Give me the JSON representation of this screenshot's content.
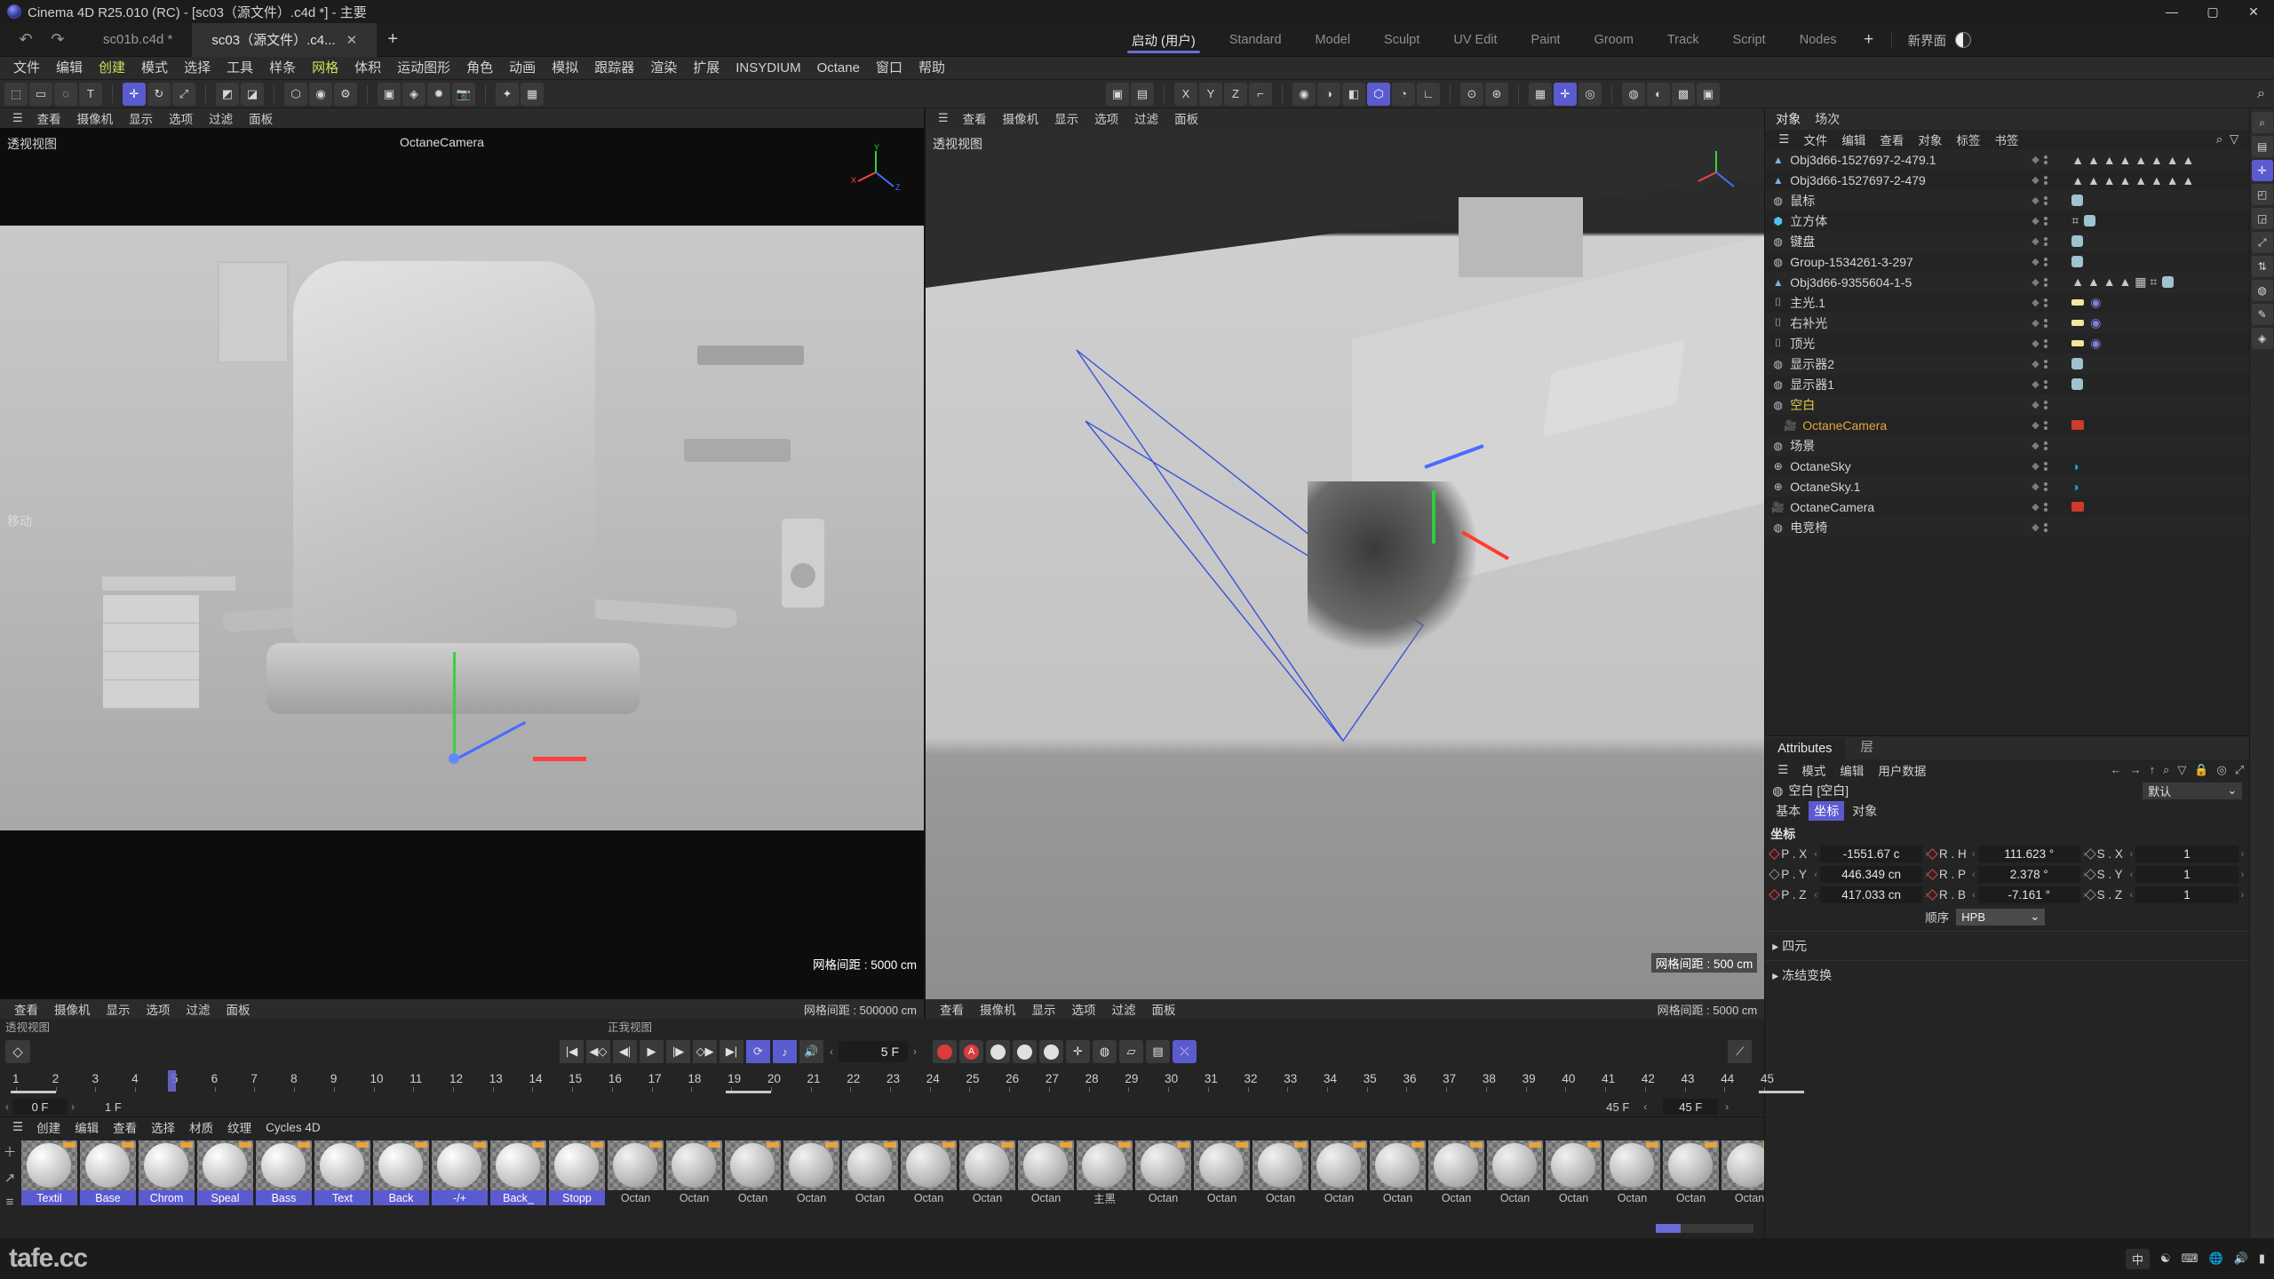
{
  "window": {
    "title": "Cinema 4D R25.010 (RC) - [sc03（源文件）.c4d *] - 主要",
    "minimize": "—",
    "maximize": "▢",
    "close": "✕"
  },
  "tabbar": {
    "undo": "↶",
    "redo": "↷",
    "documents": [
      {
        "label": "sc01b.c4d *",
        "active": false,
        "close": ""
      },
      {
        "label": "sc03（源文件）.c4...",
        "active": true,
        "close": "✕"
      }
    ],
    "add": "+",
    "layouts": [
      {
        "label": "启动 (用户)",
        "active": true
      },
      {
        "label": "Standard",
        "active": false
      },
      {
        "label": "Model",
        "active": false
      },
      {
        "label": "Sculpt",
        "active": false
      },
      {
        "label": "UV Edit",
        "active": false
      },
      {
        "label": "Paint",
        "active": false
      },
      {
        "label": "Groom",
        "active": false
      },
      {
        "label": "Track",
        "active": false
      },
      {
        "label": "Script",
        "active": false
      },
      {
        "label": "Nodes",
        "active": false
      }
    ],
    "layout_add": "+",
    "new_ui_label": "新界面"
  },
  "menubar": {
    "items": [
      {
        "label": "文件",
        "hl": false
      },
      {
        "label": "编辑",
        "hl": false
      },
      {
        "label": "创建",
        "hl": true
      },
      {
        "label": "模式",
        "hl": false
      },
      {
        "label": "选择",
        "hl": false
      },
      {
        "label": "工具",
        "hl": false
      },
      {
        "label": "样条",
        "hl": false
      },
      {
        "label": "网格",
        "hl": true
      },
      {
        "label": "体积",
        "hl": false
      },
      {
        "label": "运动图形",
        "hl": false
      },
      {
        "label": "角色",
        "hl": false
      },
      {
        "label": "动画",
        "hl": false
      },
      {
        "label": "模拟",
        "hl": false
      },
      {
        "label": "跟踪器",
        "hl": false
      },
      {
        "label": "渲染",
        "hl": false
      },
      {
        "label": "扩展",
        "hl": false
      },
      {
        "label": "INSYDIUM",
        "hl": false
      },
      {
        "label": "Octane",
        "hl": false
      },
      {
        "label": "窗口",
        "hl": false
      },
      {
        "label": "帮助",
        "hl": false
      }
    ]
  },
  "toolbar_left": {
    "groups": [
      {
        "buttons": [
          {
            "icon": "⬚",
            "name": "live-selection-tool",
            "on": false
          },
          {
            "icon": "▭",
            "name": "rectangle-selection-tool",
            "on": false
          },
          {
            "icon": "◌",
            "name": "lasso-selection-tool",
            "on": false
          },
          {
            "icon": "T",
            "name": "text-tool",
            "on": false
          }
        ]
      },
      {
        "buttons": [
          {
            "icon": "✛",
            "name": "move-tool",
            "on": true
          },
          {
            "icon": "↻",
            "name": "rotate-tool",
            "on": false
          },
          {
            "icon": "⤢",
            "name": "scale-tool",
            "on": false
          }
        ]
      },
      {
        "buttons": [
          {
            "icon": "◩",
            "name": "undo-view-button",
            "on": false
          },
          {
            "icon": "◪",
            "name": "redo-view-button",
            "on": false
          }
        ]
      },
      {
        "buttons": [
          {
            "icon": "⬡",
            "name": "render-view-button",
            "on": false
          },
          {
            "icon": "◉",
            "name": "render-region-button",
            "on": false
          },
          {
            "icon": "⚙",
            "name": "render-settings-button",
            "on": false
          }
        ]
      },
      {
        "buttons": [
          {
            "icon": "▣",
            "name": "add-cube-button",
            "on": false
          },
          {
            "icon": "◈",
            "name": "add-spline-button",
            "on": false
          },
          {
            "icon": "✹",
            "name": "add-light-button",
            "on": false
          },
          {
            "icon": "📷",
            "name": "add-camera-button",
            "on": false
          }
        ]
      },
      {
        "buttons": [
          {
            "icon": "✦",
            "name": "deformer-button",
            "on": false
          },
          {
            "icon": "▦",
            "name": "array-button",
            "on": false
          }
        ]
      }
    ]
  },
  "toolbar_right": {
    "groups": [
      {
        "buttons": [
          {
            "icon": "▣",
            "name": "object-axis-toggle",
            "on": false
          },
          {
            "icon": "▤",
            "name": "world-axis-toggle",
            "on": false
          }
        ]
      },
      {
        "buttons": [
          {
            "icon": "X",
            "name": "lock-x-axis-button",
            "on": false
          },
          {
            "icon": "Y",
            "name": "lock-y-axis-button",
            "on": false
          },
          {
            "icon": "Z",
            "name": "lock-z-axis-button",
            "on": false
          },
          {
            "icon": "⌐",
            "name": "world-coordinates-toggle",
            "on": false
          }
        ]
      },
      {
        "buttons": [
          {
            "icon": "◉",
            "name": "point-mode-button",
            "on": false
          },
          {
            "icon": "◑",
            "name": "edge-mode-button",
            "on": false
          },
          {
            "icon": "◧",
            "name": "polygon-mode-button",
            "on": false
          },
          {
            "icon": "⬡",
            "name": "model-mode-button",
            "on": true
          },
          {
            "icon": "◔",
            "name": "texture-mode-button",
            "on": false
          },
          {
            "icon": "∟",
            "name": "axis-mode-button",
            "on": false
          }
        ]
      },
      {
        "buttons": [
          {
            "icon": "⊙",
            "name": "enable-axis-button",
            "on": false
          },
          {
            "icon": "⊛",
            "name": "enable-snap-button",
            "on": false
          }
        ]
      },
      {
        "buttons": [
          {
            "icon": "▦",
            "name": "grid-snap-button",
            "on": false
          },
          {
            "icon": "✛",
            "name": "quantize-button",
            "on": true
          },
          {
            "icon": "◎",
            "name": "workplane-button",
            "on": false
          }
        ]
      },
      {
        "buttons": [
          {
            "icon": "◍",
            "name": "viewport-solo-button",
            "on": false
          },
          {
            "icon": "◐",
            "name": "layer-button",
            "on": false
          },
          {
            "icon": "▩",
            "name": "content-browser-button",
            "on": false
          },
          {
            "icon": "▣",
            "name": "asset-browser-button",
            "on": false
          }
        ]
      }
    ],
    "search_icon": "⌕"
  },
  "viewport_left": {
    "menu": [
      "查看",
      "摄像机",
      "显示",
      "选项",
      "过滤",
      "面板"
    ],
    "hamburger": "☰",
    "label": "透视视图",
    "camera": "OctaneCamera",
    "tool_label": "移动",
    "grid_spacing": "网格间距 : 5000 cm",
    "bottom_menu": [
      "查看",
      "摄像机",
      "显示",
      "选项",
      "过滤",
      "面板"
    ],
    "bottom_grid": "网格间距 : 500000 cm",
    "bottom_view_label": "透视视图"
  },
  "viewport_right": {
    "menu": [
      "查看",
      "摄像机",
      "显示",
      "选项",
      "过滤",
      "面板"
    ],
    "hamburger": "☰",
    "label": "透视视图",
    "grid_spacing": "网格间距 : 500 cm",
    "bottom_menu": [
      "查看",
      "摄像机",
      "显示",
      "选项",
      "过滤",
      "面板"
    ],
    "bottom_grid": "网格间距 : 5000 cm",
    "bottom_view_label": "正我视图"
  },
  "timeline": {
    "key_button_icon": "◇",
    "transport": [
      {
        "icon": "|◀",
        "name": "go-to-start-button",
        "on": false
      },
      {
        "icon": "◀◇",
        "name": "previous-key-button",
        "on": false
      },
      {
        "icon": "◀|",
        "name": "previous-frame-button",
        "on": false
      },
      {
        "icon": "▶",
        "name": "play-button",
        "on": false
      },
      {
        "icon": "|▶",
        "name": "next-frame-button",
        "on": false
      },
      {
        "icon": "◇▶",
        "name": "next-key-button",
        "on": false
      },
      {
        "icon": "▶|",
        "name": "go-to-end-button",
        "on": false
      },
      {
        "icon": "⟳",
        "name": "loop-toggle",
        "on": true
      },
      {
        "icon": "♪",
        "name": "sound-toggle",
        "on": true
      },
      {
        "icon": "🔊",
        "name": "audio-button",
        "on": false
      }
    ],
    "current_frame": "5 F",
    "record_buttons": [
      {
        "icon": "◉",
        "name": "record-keyframe-button",
        "style": "red"
      },
      {
        "icon": "A",
        "name": "autokey-button",
        "style": "red"
      },
      {
        "icon": "✛",
        "name": "record-position-button",
        "style": "grey"
      },
      {
        "icon": "◑",
        "name": "record-scale-button",
        "style": "grey"
      },
      {
        "icon": "◎",
        "name": "record-rotation-button",
        "style": "grey"
      },
      {
        "icon": "✛",
        "name": "keyframe-position-toggle",
        "style": "plain"
      },
      {
        "icon": "◍",
        "name": "keyframe-scale-toggle",
        "style": "plain"
      },
      {
        "icon": "▱",
        "name": "keyframe-rotation-toggle",
        "style": "plain"
      },
      {
        "icon": "▤",
        "name": "keyframe-param-toggle",
        "style": "plain"
      },
      {
        "icon": "⤫",
        "name": "keyframe-pla-toggle",
        "style": "on"
      }
    ],
    "curve_button_icon": "⟋",
    "frames": [
      1,
      2,
      3,
      4,
      5,
      6,
      7,
      8,
      9,
      10,
      11,
      12,
      13,
      14,
      15,
      16,
      17,
      18,
      19,
      20,
      21,
      22,
      23,
      24,
      25,
      26,
      27,
      28,
      29,
      30,
      31,
      32,
      33,
      34,
      35,
      36,
      37,
      38,
      39,
      40,
      41,
      42,
      43,
      44,
      45
    ],
    "playhead_frame": 5,
    "range_start": "0 F",
    "range_preview_start": "1 F",
    "range_preview_end": "45 F",
    "range_end": "45 F"
  },
  "materials": {
    "menu": [
      "创建",
      "编辑",
      "查看",
      "选择",
      "材质",
      "纹理",
      "Cycles 4D"
    ],
    "hamburger": "☰",
    "side_buttons": [
      "＋",
      "↗",
      "≡"
    ],
    "items": [
      {
        "name": "Textil",
        "kind": "std"
      },
      {
        "name": "Base",
        "kind": "std"
      },
      {
        "name": "Chrom",
        "kind": "std"
      },
      {
        "name": "Speal",
        "kind": "std"
      },
      {
        "name": "Bass",
        "kind": "std"
      },
      {
        "name": "Text",
        "kind": "std"
      },
      {
        "name": "Back",
        "kind": "std"
      },
      {
        "name": "-/+",
        "kind": "std"
      },
      {
        "name": "Back_",
        "kind": "std"
      },
      {
        "name": "Stopp",
        "kind": "std"
      },
      {
        "name": "Octan",
        "kind": "oct"
      },
      {
        "name": "Octan",
        "kind": "oct"
      },
      {
        "name": "Octan",
        "kind": "oct"
      },
      {
        "name": "Octan",
        "kind": "oct"
      },
      {
        "name": "Octan",
        "kind": "oct"
      },
      {
        "name": "Octan",
        "kind": "oct"
      },
      {
        "name": "Octan",
        "kind": "oct"
      },
      {
        "name": "Octan",
        "kind": "oct"
      },
      {
        "name": "主黑",
        "kind": "oct"
      },
      {
        "name": "Octan",
        "kind": "oct"
      },
      {
        "name": "Octan",
        "kind": "oct"
      },
      {
        "name": "Octan",
        "kind": "oct"
      },
      {
        "name": "Octan",
        "kind": "oct"
      },
      {
        "name": "Octan",
        "kind": "oct"
      },
      {
        "name": "Octan",
        "kind": "oct"
      },
      {
        "name": "Octan",
        "kind": "oct"
      },
      {
        "name": "Octan",
        "kind": "oct"
      },
      {
        "name": "Octan",
        "kind": "oct"
      },
      {
        "name": "Octan",
        "kind": "oct"
      },
      {
        "name": "Octan",
        "kind": "oct"
      }
    ]
  },
  "object_manager": {
    "tabs": [
      {
        "label": "对象",
        "active": true
      },
      {
        "label": "场次",
        "active": false
      }
    ],
    "menu": [
      "文件",
      "编辑",
      "查看",
      "对象",
      "标签",
      "书签"
    ],
    "hamburger": "☰",
    "search_icon": "⌕",
    "filter_icon": "▽",
    "items": [
      {
        "name": "Obj3d66-1527697-2-479.1",
        "icon": "▲",
        "icon_color": "#7fb0d8",
        "indent": 0,
        "state": "normal",
        "tags": "polys"
      },
      {
        "name": "Obj3d66-1527697-2-479",
        "icon": "▲",
        "icon_color": "#7fb0d8",
        "indent": 0,
        "state": "normal",
        "tags": "polys"
      },
      {
        "name": "鼠标",
        "icon": "◍",
        "icon_color": "#c0c0c0",
        "indent": 0,
        "state": "normal",
        "tags": "mat"
      },
      {
        "name": "立方体",
        "icon": "⬢",
        "icon_color": "#4bc5e8",
        "indent": 0,
        "state": "normal",
        "tags": "cube"
      },
      {
        "name": "键盘",
        "icon": "◍",
        "icon_color": "#c0c0c0",
        "indent": 0,
        "state": "normal",
        "tags": "mat"
      },
      {
        "name": "Group-1534261-3-297",
        "icon": "◍",
        "icon_color": "#c0c0c0",
        "indent": 0,
        "state": "normal",
        "tags": "mat"
      },
      {
        "name": "Obj3d66-9355604-1-5",
        "icon": "▲",
        "icon_color": "#7fb0d8",
        "indent": 0,
        "state": "normal",
        "tags": "polys2"
      },
      {
        "name": "主光.1",
        "icon": "⌷",
        "icon_color": "#d0d0d0",
        "indent": 0,
        "state": "normal",
        "tags": "light"
      },
      {
        "name": "右补光",
        "icon": "⌷",
        "icon_color": "#d0d0d0",
        "indent": 0,
        "state": "normal",
        "tags": "light"
      },
      {
        "name": "顶光",
        "icon": "⌷",
        "icon_color": "#d0d0d0",
        "indent": 0,
        "state": "normal",
        "tags": "light"
      },
      {
        "name": "显示器2",
        "icon": "◍",
        "icon_color": "#c0c0c0",
        "indent": 0,
        "state": "normal",
        "tags": "mat"
      },
      {
        "name": "显示器1",
        "icon": "◍",
        "icon_color": "#c0c0c0",
        "indent": 0,
        "state": "normal",
        "tags": "mat"
      },
      {
        "name": "空白",
        "icon": "◍",
        "icon_color": "#c0c0c0",
        "indent": 0,
        "state": "highlight",
        "tags": "none"
      },
      {
        "name": "OctaneCamera",
        "icon": "🎥",
        "icon_color": "#d0d0d0",
        "indent": 1,
        "state": "selected",
        "tags": "cam"
      },
      {
        "name": "场景",
        "icon": "◍",
        "icon_color": "#c0c0c0",
        "indent": 0,
        "state": "normal",
        "tags": "none"
      },
      {
        "name": "OctaneSky",
        "icon": "⊕",
        "icon_color": "#c0c0c0",
        "indent": 0,
        "state": "normal",
        "tags": "sky"
      },
      {
        "name": "OctaneSky.1",
        "icon": "⊕",
        "icon_color": "#c0c0c0",
        "indent": 0,
        "state": "normal",
        "tags": "sky"
      },
      {
        "name": "OctaneCamera",
        "icon": "🎥",
        "icon_color": "#c0c0c0",
        "indent": 0,
        "state": "normal",
        "tags": "cam"
      },
      {
        "name": "电竞椅",
        "icon": "◍",
        "icon_color": "#c0c0c0",
        "indent": 0,
        "state": "normal",
        "tags": "none"
      }
    ]
  },
  "attributes": {
    "tabs": [
      {
        "label": "Attributes",
        "active": true
      },
      {
        "label": "层",
        "active": false
      }
    ],
    "menu": [
      "模式",
      "编辑",
      "用户数据"
    ],
    "hamburger": "☰",
    "nav_icons": [
      "←",
      "→",
      "↑",
      "⌕",
      "▽",
      "🔒",
      "◎",
      "⤢"
    ],
    "object_title": "空白 [空白]",
    "preset": "默认",
    "preset_caret": "⌄",
    "subtabs": [
      {
        "label": "基本",
        "active": false
      },
      {
        "label": "坐标",
        "active": true
      },
      {
        "label": "对象",
        "active": false
      }
    ],
    "section_title": "坐标",
    "rows": [
      {
        "p_label": "P . X",
        "p_value": "-1551.67 c",
        "p_key": true,
        "r_label": "R . H",
        "r_value": "111.623 °",
        "r_key": true,
        "s_label": "S . X",
        "s_value": "1",
        "s_key": false
      },
      {
        "p_label": "P . Y",
        "p_value": "446.349 cn",
        "p_key": false,
        "r_label": "R . P",
        "r_value": "2.378 °",
        "r_key": true,
        "s_label": "S . Y",
        "s_value": "1",
        "s_key": false
      },
      {
        "p_label": "P . Z",
        "p_value": "417.033 cn",
        "p_key": true,
        "r_label": "R . B",
        "r_value": "-7.161 °",
        "r_key": true,
        "s_label": "S . Z",
        "s_value": "1",
        "s_key": false
      }
    ],
    "order_label": "顺序",
    "order_value": "HPB",
    "collapsed": [
      "四元",
      "冻结变换"
    ]
  },
  "vstrip": {
    "buttons": [
      {
        "icon": "⌕",
        "name": "search-icon",
        "on": false
      },
      {
        "icon": "▤",
        "name": "layer-palette-button",
        "on": false
      },
      {
        "icon": "✛",
        "name": "move-palette-button",
        "on": true
      },
      {
        "icon": "◰",
        "name": "coordinate-palette-button",
        "on": false
      },
      {
        "icon": "◲",
        "name": "structure-palette-button",
        "on": false
      },
      {
        "icon": "⤢",
        "name": "scale-palette-button",
        "on": false
      },
      {
        "icon": "⇅",
        "name": "arrange-palette-button",
        "on": false
      },
      {
        "icon": "◍",
        "name": "material-palette-button",
        "on": false
      },
      {
        "icon": "✎",
        "name": "paint-palette-button",
        "on": false
      },
      {
        "icon": "◈",
        "name": "spline-palette-button",
        "on": false
      }
    ]
  },
  "statusbar": {
    "text": "",
    "progress_percent": 25
  },
  "taskbar": {
    "logo": "tafe.cc",
    "tray": [
      "中",
      "☯",
      "⌨",
      "🌐",
      "🔊",
      "▮"
    ],
    "ime_label": "中"
  }
}
